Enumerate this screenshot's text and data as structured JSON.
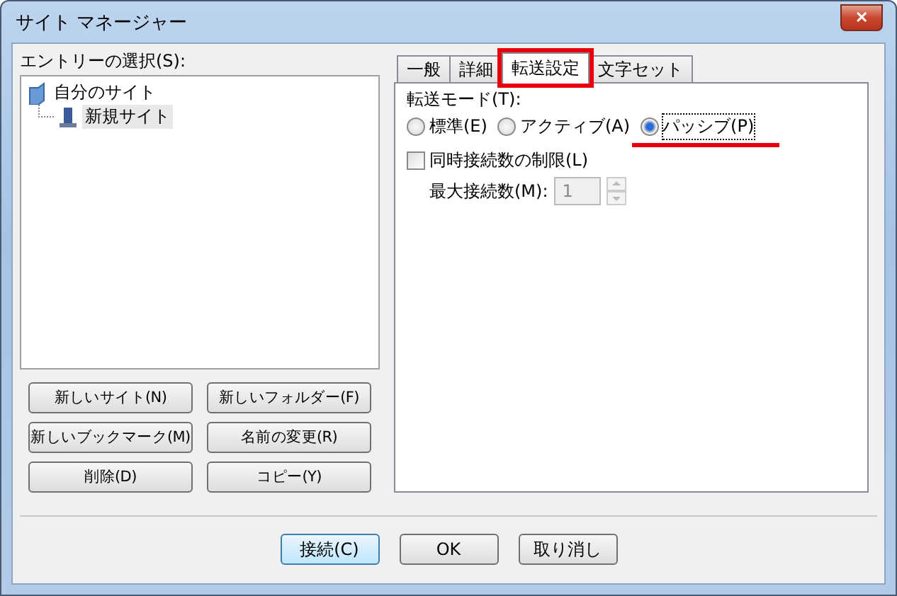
{
  "window": {
    "title": "サイト マネージャー",
    "close": "✕"
  },
  "entries": {
    "label": "エントリーの選択(S):",
    "tree": [
      {
        "label": "自分のサイト",
        "kind": "folder",
        "selected": false,
        "children": [
          {
            "label": "新規サイト",
            "kind": "site",
            "selected": true
          }
        ]
      }
    ]
  },
  "entry_buttons": [
    "新しいサイト(N)",
    "新しいフォルダー(F)",
    "新しいブックマーク(M)",
    "名前の変更(R)",
    "削除(D)",
    "コピー(Y)"
  ],
  "tabs": [
    {
      "label": "一般",
      "selected": false,
      "highlighted": false
    },
    {
      "label": "詳細",
      "selected": false,
      "highlighted": false
    },
    {
      "label": "転送設定",
      "selected": true,
      "highlighted": true
    },
    {
      "label": "文字セット",
      "selected": false,
      "highlighted": false
    }
  ],
  "transfer_mode": {
    "label": "転送モード(T):",
    "options": [
      {
        "label": "標準(E)",
        "selected": false,
        "underlined": false
      },
      {
        "label": "アクティブ(A)",
        "selected": false,
        "underlined": false
      },
      {
        "label": "パッシブ(P)",
        "selected": true,
        "underlined": true
      }
    ]
  },
  "limit_connections": {
    "label": "同時接続数の制限(L)",
    "checked": false
  },
  "max_connections": {
    "label": "最大接続数(M):",
    "value": "1",
    "disabled": true
  },
  "buttons": [
    {
      "label": "接続(C)",
      "default": true
    },
    {
      "label": "OK",
      "default": false
    },
    {
      "label": "取り消し",
      "default": false
    }
  ]
}
